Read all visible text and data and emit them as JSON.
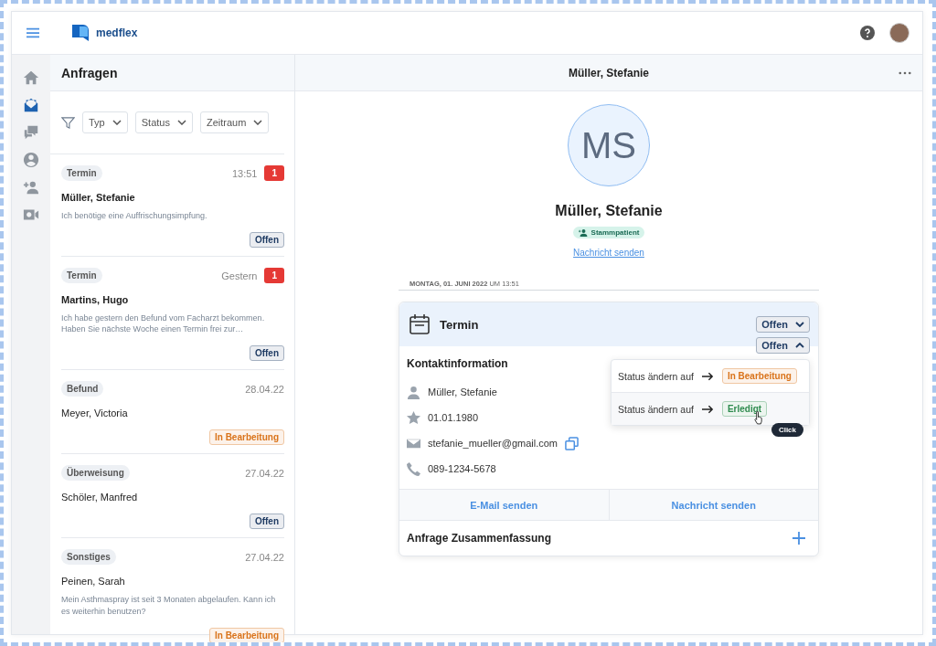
{
  "topbar": {
    "logo": "medflex"
  },
  "nav": [
    {
      "kind": "home",
      "selected": false
    },
    {
      "kind": "inbox",
      "selected": true
    },
    {
      "kind": "chat",
      "selected": false
    },
    {
      "kind": "user",
      "selected": false
    },
    {
      "kind": "add-user",
      "selected": false
    },
    {
      "kind": "video",
      "selected": false
    }
  ],
  "list": {
    "title": "Anfragen",
    "filters": [
      "Typ",
      "Status",
      "Zeitraum"
    ],
    "items": [
      {
        "type": "Termin",
        "time": "13:51",
        "unread": true,
        "badge": "1",
        "name": "Müller, Stefanie",
        "message": "Ich benötige eine Auffrischungsimpfung.",
        "status": "Offen",
        "color": "#1f3b63"
      },
      {
        "type": "Termin",
        "time": "Gestern",
        "unread": true,
        "badge": "1",
        "name": "Martins, Hugo",
        "message": "Ich habe gestern den Befund vom Facharzt bekommen. Haben Sie nächste Woche einen Termin frei zur…",
        "status": "Offen",
        "color": "#1f3b63"
      },
      {
        "type": "Befund",
        "time": "28.04.22",
        "unread": false,
        "name": "Meyer, Victoria",
        "status": "In Bearbeitung",
        "color": "#d9731a"
      },
      {
        "type": "Überweisung",
        "time": "27.04.22",
        "unread": false,
        "name": "Schöler, Manfred",
        "status": "Offen",
        "color": "#1f3b63"
      },
      {
        "type": "Sonstiges",
        "time": "27.04.22",
        "unread": false,
        "name": "Peinen, Sarah",
        "message": "Mein Asthmaspray ist seit 3 Monaten abgelaufen. Kann ich es weiterhin benutzen?",
        "status": "In Bearbeitung",
        "color": "#d9731a"
      }
    ]
  },
  "detail": {
    "title": "Müller, Stefanie",
    "initials": "MS",
    "name": "Müller, Stefanie",
    "tag": "Stammpatient",
    "link": "Nachricht senden",
    "date": "**MONTAG, 01. JUNI 2022** UM 13:51",
    "card": {
      "title": "Termin",
      "status": "Offen",
      "color": "#1f3b63",
      "dropdown": {
        "label": "Offen",
        "expanded": true,
        "options": [
          {
            "label": "Status ändern auf",
            "target": "In Bearbeitung",
            "color": "#d9731a",
            "hovered": false
          },
          {
            "label": "Status ändern auf",
            "target": "Erledigt",
            "color": "#2e8b4e",
            "hovered": true
          }
        ],
        "tooltip": "Click"
      },
      "contact_title": "Kontaktinformation",
      "contact": [
        {
          "kind": "person",
          "value": "Müller, Stefanie"
        },
        {
          "kind": "birthday",
          "value": "01.01.1980"
        },
        {
          "kind": "email",
          "value": "stefanie_mueller@gmail.com",
          "copyable": true
        },
        {
          "kind": "phone",
          "value": "089-1234-5678"
        }
      ],
      "actions": [
        "E-Mail senden",
        "Nachricht senden"
      ],
      "summary": "Anfrage Zusammenfassung"
    }
  }
}
